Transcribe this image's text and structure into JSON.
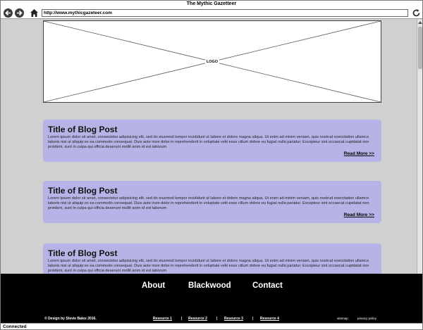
{
  "window": {
    "title": "The Mythic Gazetteer"
  },
  "toolbar": {
    "url": "http://www.mythicgazeteer.com"
  },
  "header": {
    "logo_label": "LOGO"
  },
  "posts": [
    {
      "title": "Title of Blog Post",
      "body": "Lorem ipsum dolor sit amet, consectetur adipisicing elit, sed do eiusmod tempor incididunt ut labore et dolore magna aliqua. Ut enim ad minim veniam, quis nostrud exercitation ullamco laboris nisi ut aliquip ex ea commodo consequat. Duis aute irure dolor in reprehenderit in voluptate velit esse cillum dolore eu fugiat nulla pariatur. Excepteur sint occaecat cupidatat non proident, sunt in culpa qui officia deserunt mollit anim id est laborum",
      "read_more": "Read More >>"
    },
    {
      "title": "Title of Blog Post",
      "body": "Lorem ipsum dolor sit amet, consectetur adipisicing elit, sed do eiusmod tempor incididunt ut labore et dolore magna aliqua. Ut enim ad minim veniam, quis nostrud exercitation ullamco laboris nisi ut aliquip ex ea commodo consequat. Duis aute irure dolor in reprehenderit in voluptate velit esse cillum dolore eu fugiat nulla pariatur. Excepteur sint occaecat cupidatat non proident, sunt in culpa qui officia deserunt mollit anim id est laborum",
      "read_more": "Read More >>"
    },
    {
      "title": "Title of Blog Post",
      "body": "Lorem ipsum dolor sit amet, consectetur adipisicing elit, sed do eiusmod tempor incididunt ut labore et dolore magna aliqua. Ut enim ad minim veniam, quis nostrud exercitation ullamco laboris nisi ut aliquip ex ea commodo consequat. Duis aute irure dolor in reprehenderit in voluptate velit esse cillum dolore eu fugiat nulla pariatur. Excepteur sint occaecat cupidatat non proident, sunt in culpa qui officia deserunt mollit anim id est laborum"
    }
  ],
  "footer": {
    "nav": [
      "About",
      "Blackwood",
      "Contact"
    ],
    "copyright": "© Design by Stevie Bales 2016.",
    "resources": [
      "Resource 1",
      "Resource 2",
      "Resource 3",
      "Resource 4"
    ],
    "separator": "|",
    "sitemap": "sitemap",
    "privacy": "privacy policy"
  },
  "status": {
    "text": "Connected"
  },
  "colors": {
    "post_bg": "#b6b4e6",
    "page_bg": "#d0d0d0",
    "footer_bg": "#000000"
  },
  "icons": [
    "back-arrow-icon",
    "forward-arrow-icon",
    "home-icon",
    "reload-icon",
    "scroll-up-icon"
  ]
}
